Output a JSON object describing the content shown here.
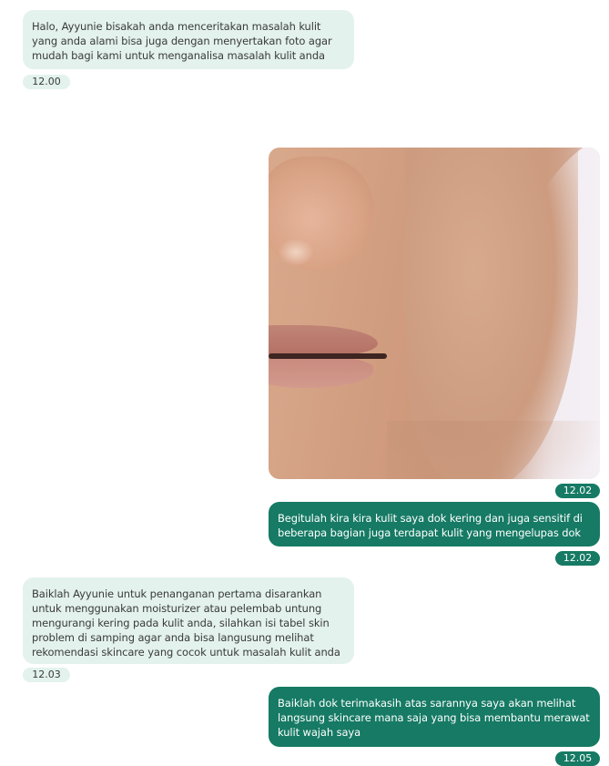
{
  "messages": [
    {
      "id": "m1",
      "sender": "doctor",
      "text": "Halo, Ayyunie bisakah anda menceritakan masalah kulit yang anda alami bisa juga dengan menyertakan foto agar mudah bagi kami untuk menganalisa masalah kulit anda",
      "time": "12.00"
    },
    {
      "id": "m2",
      "sender": "user",
      "type": "image",
      "image": "face-close-up-photo",
      "time": "12.02"
    },
    {
      "id": "m3",
      "sender": "user",
      "text": "Begitulah kira kira kulit saya dok kering dan juga sensitif di beberapa bagian juga terdapat kulit yang mengelupas dok",
      "time": "12.02"
    },
    {
      "id": "m4",
      "sender": "doctor",
      "text": "Baiklah Ayyunie untuk penanganan pertama disarankan untuk  menggunakan moisturizer atau pelembab untung mengurangi kering pada kulit anda, silahkan isi tabel skin problem di samping agar anda bisa langusung melihat rekomendasi skincare yang cocok untuk masalah kulit anda",
      "time": "12.03"
    },
    {
      "id": "m5",
      "sender": "user",
      "text": "Baiklah dok terimakasih atas sarannya saya akan melihat langsung skincare mana saja yang bisa membantu merawat kulit wajah saya",
      "time": "12.05"
    }
  ],
  "colors": {
    "incoming_bubble": "#e3f2ed",
    "outgoing_bubble": "#167a64",
    "incoming_text": "#3a3a3a",
    "outgoing_text": "#ffffff"
  }
}
